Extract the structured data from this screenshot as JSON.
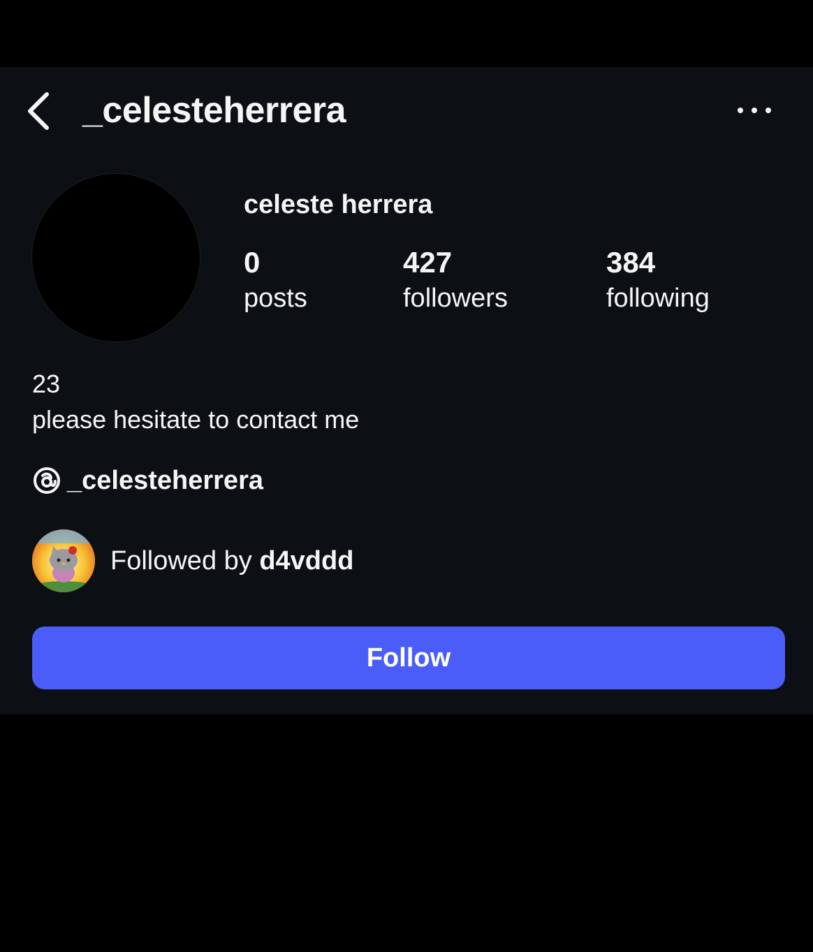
{
  "header": {
    "username": "_celesteherrera",
    "back_icon": "chevron-left-icon",
    "more_icon": "more-horizontal-icon"
  },
  "profile": {
    "display_name": "celeste herrera",
    "avatar_color": "#000000",
    "stats": [
      {
        "value": "0",
        "label": "posts"
      },
      {
        "value": "427",
        "label": "followers"
      },
      {
        "value": "384",
        "label": "following"
      }
    ],
    "bio": [
      "23",
      "please hesitate to contact me"
    ],
    "threads": {
      "icon": "threads-icon",
      "handle": "_celesteherrera"
    },
    "followed_by": {
      "prefix": "Followed by",
      "user": "d4vddd"
    }
  },
  "actions": {
    "follow_label": "Follow",
    "follow_color": "#4a5df9"
  },
  "theme": {
    "panel_background": "#0c1014",
    "page_background": "#000000",
    "text_color": "#f5f5f5"
  }
}
